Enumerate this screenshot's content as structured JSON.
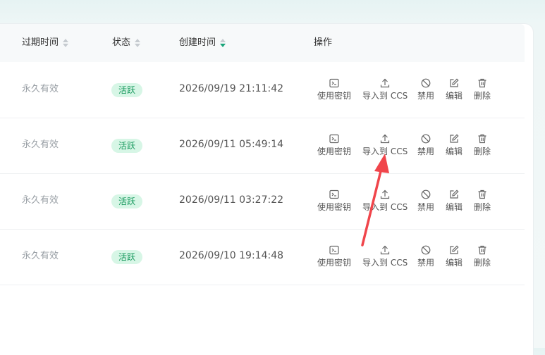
{
  "table": {
    "headers": {
      "expire": "过期时间",
      "status": "状态",
      "created": "创建时间",
      "actions": "操作"
    },
    "actions": {
      "use_key": "使用密钥",
      "import_ccs": "导入到 CCS",
      "disable": "禁用",
      "edit": "编辑",
      "delete": "删除"
    },
    "rows": [
      {
        "expire": "永久有效",
        "status": "活跃",
        "created": "2026/09/19 21:11:42"
      },
      {
        "expire": "永久有效",
        "status": "活跃",
        "created": "2026/09/11 05:49:14"
      },
      {
        "expire": "永久有效",
        "status": "活跃",
        "created": "2026/09/11 03:27:22"
      },
      {
        "expire": "永久有效",
        "status": "活跃",
        "created": "2026/09/10 19:14:48"
      }
    ]
  },
  "icons": {
    "use_key": "terminal-icon",
    "import_ccs": "upload-icon",
    "disable": "ban-icon",
    "edit": "edit-icon",
    "delete": "trash-icon",
    "annotation": "red-arrow-icon"
  },
  "colors": {
    "badge_bg": "#d7f6e6",
    "badge_text": "#1a9a5f",
    "sort_active": "#1aa57a",
    "annotation_arrow": "#f0454b"
  }
}
